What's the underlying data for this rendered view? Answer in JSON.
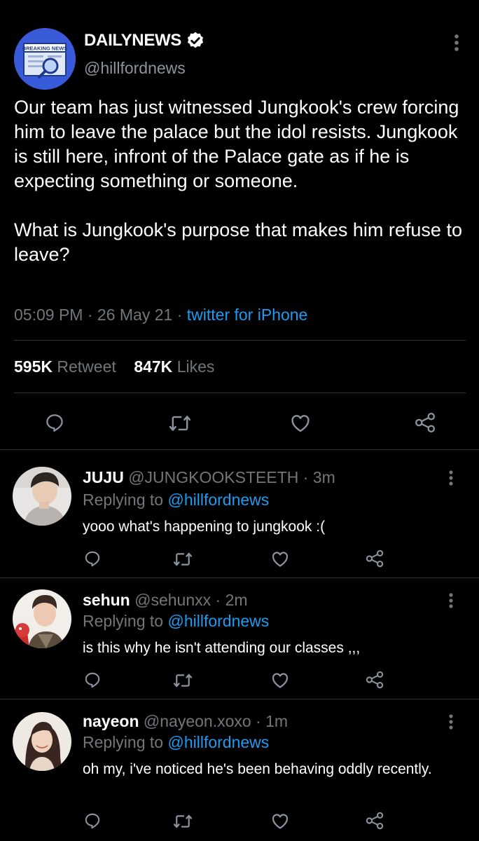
{
  "tweet": {
    "avatar_text": "BREAKING NEWS",
    "author_name": "DAILYNEWS",
    "author_handle": "@hillfordnews",
    "text": "Our team has just witnessed Jungkook's crew forcing him to leave the palace but the idol resists. Jungkook is still here, infront of the Palace gate as if he is expecting something or someone.\n\nWhat is Jungkook's purpose that makes him refuse to leave?",
    "time": "05:09 PM",
    "sep1": " · ",
    "date": "26 May 21",
    "sep2": " · ",
    "source": "twitter for iPhone",
    "retweet_count": "595K",
    "retweet_label": "Retweet",
    "like_count": "847K",
    "like_label": "Likes"
  },
  "replies": [
    {
      "name": "JUJU",
      "handle": "@JUNGKOOKSTEETH",
      "time": " · 3m",
      "replying_label": "Replying to ",
      "replying_to": "@hillfordnews",
      "text": "yooo what's happening to jungkook :("
    },
    {
      "name": "sehun",
      "handle": "@sehunxx",
      "time": " · 2m",
      "replying_label": "Replying to ",
      "replying_to": "@hillfordnews",
      "text": "is this why he isn't attending our classes ,,,"
    },
    {
      "name": "nayeon",
      "handle": "@nayeon.xoxo",
      "time": " · 1m",
      "replying_label": "Replying to ",
      "replying_to": "@hillfordnews",
      "text": "oh my, i've noticed he's been behaving oddly recently."
    }
  ],
  "colors": {
    "background": "#000000",
    "link": "#1d9bf0",
    "muted": "#71767b",
    "divider": "#2f3336"
  }
}
